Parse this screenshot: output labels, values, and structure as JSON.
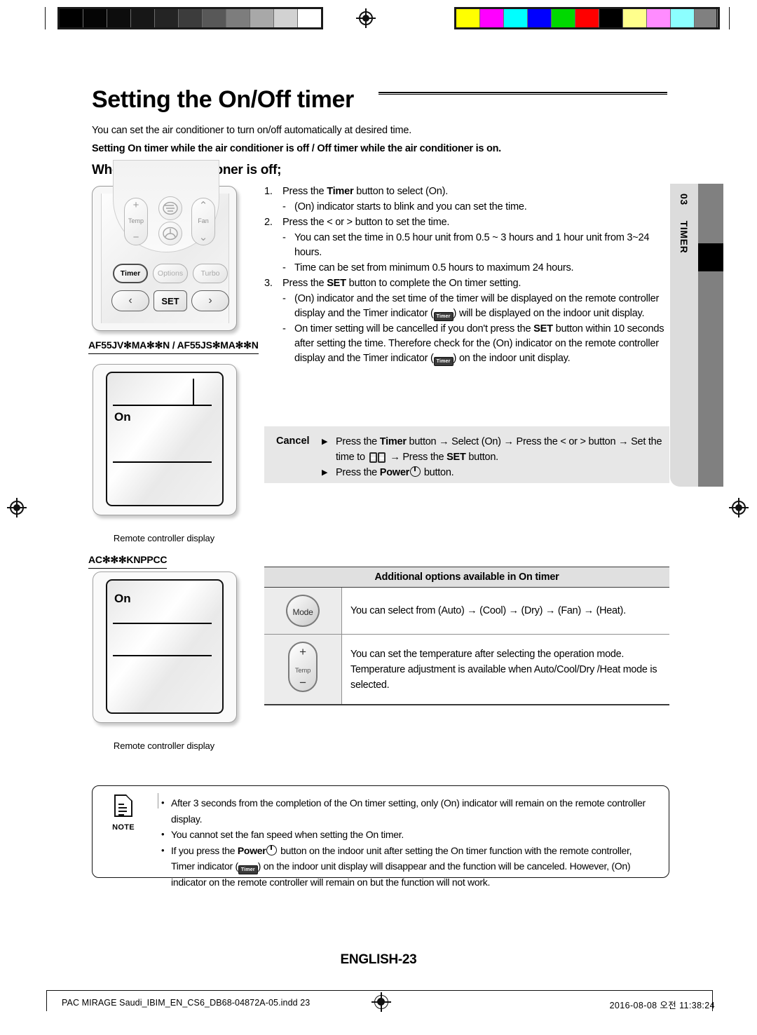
{
  "calibration": {
    "gray_swatches": [
      "#000000",
      "#050505",
      "#0d0d0d",
      "#171717",
      "#242424",
      "#3c3c3c",
      "#585858",
      "#7d7d7d",
      "#a8a8a8",
      "#d2d2d2",
      "#ffffff"
    ],
    "color_swatches": [
      "#ffff00",
      "#ff00ff",
      "#00ffff",
      "#0000ff",
      "#00d900",
      "#ff0000",
      "#000000",
      "#ffff8c",
      "#ff8cff",
      "#8cffff",
      "#808080"
    ]
  },
  "header": {
    "title": "Setting the On/Off timer",
    "intro": "You can set the air conditioner to turn on/off automatically at desired time.",
    "subhead": "Setting On timer while the air conditioner is off / Off timer while the air conditioner is on.",
    "section": "When the air conditioner is off;"
  },
  "chapter_tab": {
    "number": "03",
    "label": "TIMER"
  },
  "remote": {
    "temp_label": "Temp",
    "fan_label": "Fan",
    "plus": "+",
    "minus": "−",
    "up": "⌃",
    "down": "⌄",
    "timer_label": "Timer",
    "options_label": "Options",
    "turbo_label": "Turbo",
    "set_label": "SET",
    "left_arrow": "‹",
    "right_arrow": "›"
  },
  "displays": [
    {
      "model": "AF55JV✻MA✻✻N / AF55JS✻MA✻✻N",
      "on_text": "On",
      "caption": "Remote controller display"
    },
    {
      "model": "AC✻✻✻KNPPCC",
      "on_text": "On",
      "caption": "Remote controller display"
    }
  ],
  "steps": [
    {
      "num": "1.",
      "text_a": "Press the ",
      "bold": "Timer",
      "text_b": " button to select (On)."
    },
    {
      "num": "2.",
      "text_a": "Press the < or > button to set the time.",
      "bold": "",
      "text_b": ""
    },
    {
      "num": "3.",
      "text_a": "Press the ",
      "bold": "SET",
      "text_b": " button to complete the On timer setting."
    }
  ],
  "substeps": {
    "s1a": "(On) indicator starts to blink and you can set the time.",
    "s2a": "You can set the time in 0.5 hour unit from 0.5 ~ 3 hours and 1 hour unit from 3~24 hours.",
    "s2b": "Time can be set from minimum 0.5 hours to maximum 24 hours.",
    "s3a_1": "(On) indicator and the set time of the timer will be displayed on the remote controller display and the Timer indicator (",
    "s3a_2": ") will be displayed on the indoor unit display.",
    "s3b_1": "On timer setting will be cancelled if you don't press the ",
    "s3b_bold": "SET",
    "s3b_2": " button within 10 seconds after setting the time. Therefore check for the (On) indicator on the remote controller display and the Timer indicator (",
    "s3b_3": ") on the indoor unit display."
  },
  "timer_indicator_label": "Timer",
  "cancel": {
    "label": "Cancel",
    "bullet": "▶",
    "row1_a": "Press the ",
    "row1_timer": "Timer",
    "row1_b": " button → Select (On) → Press the < or > button → Set the time to ",
    "row1_c": " → Press the ",
    "row1_set": "SET",
    "row1_d": " button.",
    "row2_a": "Press the ",
    "row2_power": "Power",
    "row2_b": " button."
  },
  "options_table": {
    "header": "Additional options available in On timer",
    "rows": [
      {
        "icon": "mode-button-icon",
        "icon_label": "Mode",
        "lines": [
          "You can select from (Auto) → (Cool) → (Dry) → (Fan) → (Heat)."
        ]
      },
      {
        "icon": "temp-button-icon",
        "icon_label": "Temp",
        "icon_plus": "+",
        "icon_minus": "−",
        "lines": [
          "You can set the temperature after selecting the operation mode.",
          "Temperature adjustment is available when Auto/Cool/Dry /Heat mode is selected."
        ]
      }
    ]
  },
  "note": {
    "word": "NOTE",
    "bullet": "•",
    "items": [
      {
        "text": "After 3 seconds from the completion of the On timer setting, only (On) indicator will remain on the remote controller display."
      },
      {
        "text": "You cannot set the fan speed when setting the On timer."
      },
      {
        "text_a": "If you press the ",
        "bold": "Power",
        "text_b": " button on the indoor unit after setting the On timer function with the remote controller, Timer indicator (",
        "text_c": ") on the indoor unit display will disappear and the function will be canceled. However, (On) indicator on the remote controller will remain on but the function will not work."
      }
    ]
  },
  "footer": {
    "page": "ENGLISH-23",
    "file": "PAC MIRAGE Saudi_IBIM_EN_CS6_DB68-04872A-05.indd   23",
    "timestamp": "2016-08-08   오전 11:38:24"
  }
}
